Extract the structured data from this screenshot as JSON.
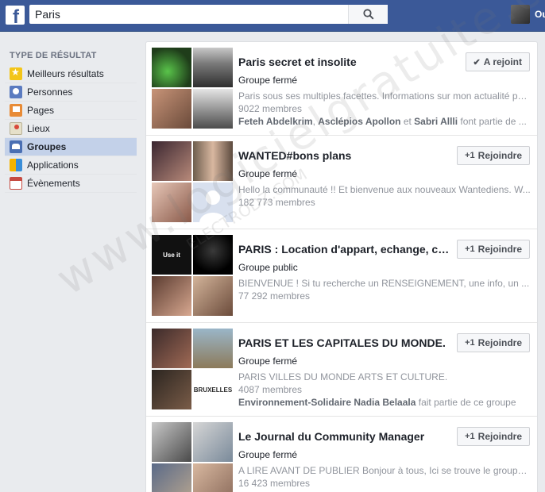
{
  "topbar": {
    "search_value": "Paris",
    "profile_name": "Ou",
    "colors": {
      "brand": "#3b5998"
    }
  },
  "sidebar": {
    "title": "TYPE DE RÉSULTAT",
    "items": [
      {
        "label": "Meilleurs résultats",
        "icon": "star-icon"
      },
      {
        "label": "Personnes",
        "icon": "people-icon"
      },
      {
        "label": "Pages",
        "icon": "flag-icon"
      },
      {
        "label": "Lieux",
        "icon": "map-pin-icon"
      },
      {
        "label": "Groupes",
        "icon": "group-icon",
        "active": true
      },
      {
        "label": "Applications",
        "icon": "apps-icon"
      },
      {
        "label": "Évènements",
        "icon": "calendar-icon"
      }
    ]
  },
  "results": [
    {
      "title": "Paris secret et insolite",
      "type": "Groupe fermé",
      "description": "Paris sous ses multiples facettes. Informations sur mon actualité pa...",
      "members": "9022 membres",
      "friends": {
        "names": [
          "Feteh Abdelkrim",
          "Asclépios Apollon",
          "Sabri Allli"
        ],
        "sep1": ", ",
        "sep2": " et ",
        "suffix": " font partie de ..."
      },
      "button": {
        "label": "A rejoint",
        "icon": "check-icon",
        "glyph": "✔"
      }
    },
    {
      "title": "WANTED#bons plans",
      "type": "Groupe fermé",
      "description": "Hello la communauté !! Et bienvenue aux nouveaux Wantediens. W...",
      "members": "182 773 membres",
      "button": {
        "label": "Rejoindre",
        "icon": "plus-one-icon",
        "glyph": "+1"
      }
    },
    {
      "title": "PARIS : Location d'appart, echange, col...",
      "type": "Groupe public",
      "description": "BIENVENUE ! Si tu recherche un RENSEIGNEMENT, une info, un ...",
      "members": "77 292 membres",
      "thumb_text": "Use it",
      "button": {
        "label": "Rejoindre",
        "icon": "plus-one-icon",
        "glyph": "+1"
      }
    },
    {
      "title": "PARIS ET LES CAPITALES DU MONDE.",
      "type": "Groupe fermé",
      "description": "PARIS VILLES DU MONDE ARTS ET CULTURE.",
      "members": "4087 membres",
      "friends": {
        "names": [
          "Environnement-Solidaire Nadia Belaala"
        ],
        "suffix": " fait partie de ce groupe"
      },
      "thumb_text": "BRUXELLES",
      "button": {
        "label": "Rejoindre",
        "icon": "plus-one-icon",
        "glyph": "+1"
      }
    },
    {
      "title": "Le Journal du Community Manager",
      "type": "Groupe fermé",
      "description": "A LIRE AVANT DE PUBLIER Bonjour à tous, Ici se trouve le groupe...",
      "members": "16 423 membres",
      "button": {
        "label": "Rejoindre",
        "icon": "plus-one-icon",
        "glyph": "+1"
      }
    }
  ],
  "watermark": {
    "main": "www.logicielgratuite.com",
    "secondary": "ELECTRODZ.COM"
  }
}
